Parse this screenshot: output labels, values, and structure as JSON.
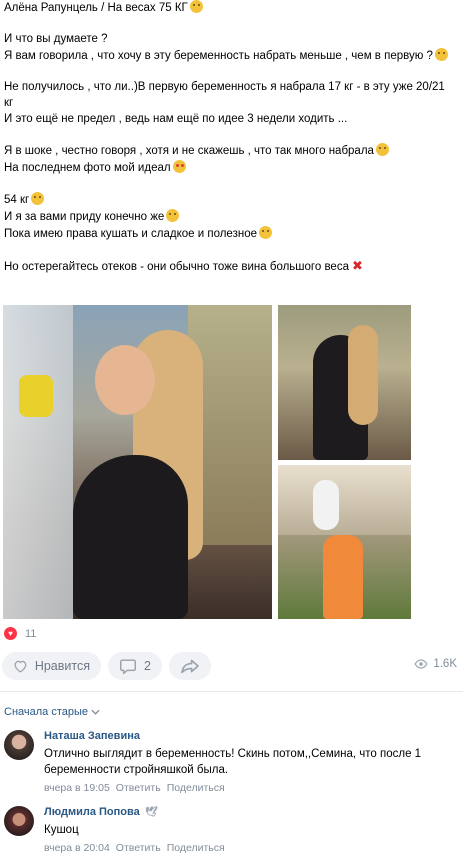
{
  "post": {
    "lines": [
      {
        "text": "Алёна Рапунцель / На весах 75 КГ",
        "emoji": "dizzy"
      },
      {
        "text": "",
        "emoji": ""
      },
      {
        "text": "И что вы думаете ?",
        "emoji": ""
      },
      {
        "text": "Я вам говорила , что хочу в эту беременность набрать меньше , чем в первую ?",
        "emoji": "smile"
      },
      {
        "text": "",
        "emoji": ""
      },
      {
        "text": "Не получилось , что ли..)В первую беременность я набрала 17 кг - в эту уже 20/21",
        "emoji": ""
      },
      {
        "text": "кг",
        "emoji": ""
      },
      {
        "text": "И это ещё не предел , ведь нам ещё по идее 3 недели ходить ...",
        "emoji": ""
      },
      {
        "text": "",
        "emoji": ""
      },
      {
        "text": "Я в шоке , честно говоря , хотя и не скажешь , что так много набрала",
        "emoji": "surprised"
      },
      {
        "text": "На последнем фото мой идеал",
        "emoji": "hearteyes"
      },
      {
        "text": "",
        "emoji": ""
      },
      {
        "text": "54 кг",
        "emoji": "smile"
      },
      {
        "text": "И я за вами приду конечно же",
        "emoji": "party"
      },
      {
        "text": "Пока имею права кушать и сладкое и полезное",
        "emoji": "smile"
      },
      {
        "text": "",
        "emoji": ""
      },
      {
        "text": "Но остерегайтесь отеков - они обычно тоже вина большого веса",
        "emoji": "x"
      }
    ]
  },
  "reactions": {
    "count": "11"
  },
  "actions": {
    "like_label": "Нравится",
    "comments_count": "2",
    "views": "1.6K"
  },
  "comments_sort": "Сначала старые",
  "comments": [
    {
      "author": "Наташа Запевина",
      "text": "Отлично выглядит в беременность! Скинь потом,,Семина, что после 1 беременности стройняшкой была.",
      "time": "вчера в 19:05",
      "reply": "Ответить",
      "share": "Поделиться"
    },
    {
      "author": "Людмила Попова",
      "text": "Кушоц",
      "time": "вчера в 20:04",
      "reply": "Ответить",
      "share": "Поделиться"
    }
  ],
  "colors": {
    "link": "#2a5885",
    "muted": "#818c99",
    "button_bg": "#f0f2f5",
    "heart": "#ff3347"
  },
  "icons": [
    "heart-icon",
    "comment-icon",
    "share-icon",
    "eye-icon",
    "chevron-down-icon",
    "bird-icon"
  ]
}
